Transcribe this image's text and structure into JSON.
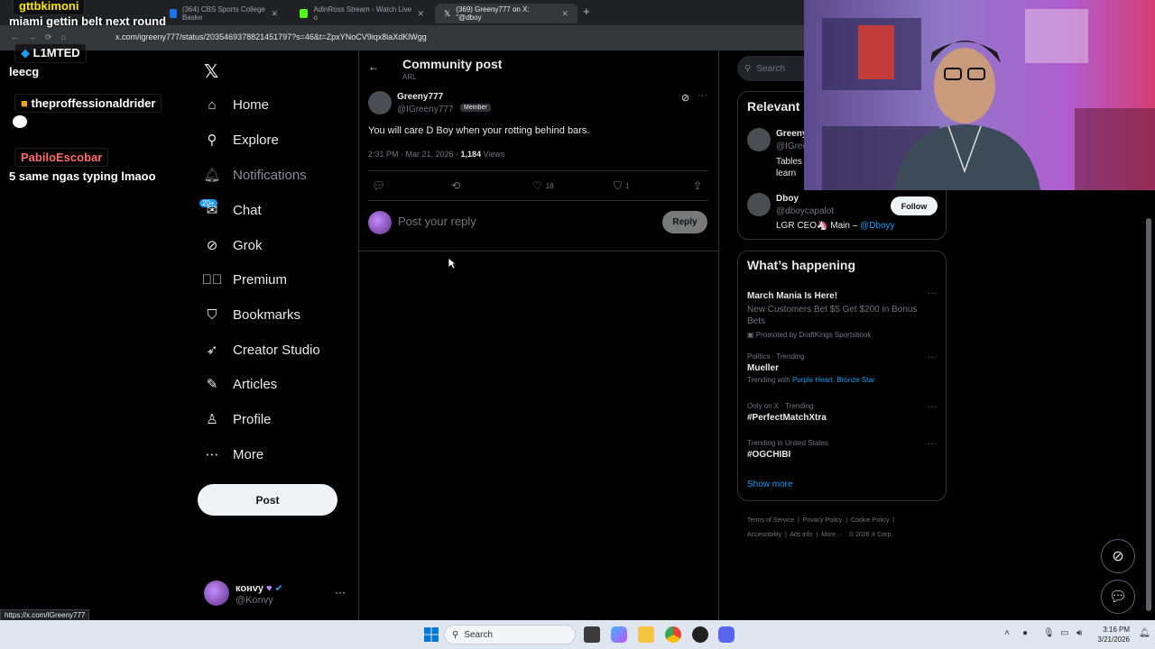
{
  "browser": {
    "tabs": [
      {
        "label": "(364) CBS Sports College Baske",
        "favicon_color": "#1a73e8"
      },
      {
        "label": "AdinRoss Stream - Watch Live o",
        "favicon_color": "#53fc18"
      },
      {
        "label": "(369) Greeny777 on X: \"@dboy",
        "favicon_color": "#000000"
      }
    ],
    "url": "x.com/igreeny777/status/2035469378821451797?s=46&t=ZpxYNoCV9iqx8iaXdKlWgg",
    "status_url": "https://x.com/IGreeny777"
  },
  "chat_overlay": {
    "lines": [
      {
        "user": "gttbkimoni",
        "message": "miami gettin belt next round"
      },
      {
        "user": "L1MTED",
        "message": "leecg"
      },
      {
        "user": "theproffessionaldrider",
        "message": ""
      },
      {
        "user": "PabiloEscobar",
        "message": "5 same ngas typing lmaoo"
      }
    ]
  },
  "nav": {
    "items": [
      {
        "label": "Home",
        "icon": "home-icon"
      },
      {
        "label": "Explore",
        "icon": "search-icon"
      },
      {
        "label": "Notifications",
        "icon": "bell-icon"
      },
      {
        "label": "Chat",
        "icon": "mail-icon"
      },
      {
        "label": "Grok",
        "icon": "grok-icon"
      },
      {
        "label": "Premium",
        "icon": "verified-icon"
      },
      {
        "label": "Bookmarks",
        "icon": "bookmark-icon"
      },
      {
        "label": "Creator Studio",
        "icon": "rocket-icon"
      },
      {
        "label": "Articles",
        "icon": "article-icon"
      },
      {
        "label": "Profile",
        "icon": "person-icon"
      },
      {
        "label": "More",
        "icon": "more-circle-icon"
      }
    ],
    "chat_badge": "20+",
    "post_label": "Post"
  },
  "account": {
    "name": "конvy",
    "handle": "@Konvy"
  },
  "main": {
    "title": "Community post",
    "subtitle": "ARL",
    "post": {
      "name": "Greeny777",
      "handle": "@IGreeny777",
      "badge": "Member",
      "text": "You will care D Boy when your rotting behind bars.",
      "time": "2:31 PM · Mar 21, 2026 · ",
      "views": "1,184",
      "views_label": " Views",
      "likes": "18",
      "bookmarks": "1"
    },
    "reply_placeholder": "Post your reply",
    "reply_label": "Reply"
  },
  "sidebar": {
    "search_placeholder": "Search",
    "relevant_title": "Relevant people",
    "people": [
      {
        "name": "Greeny777",
        "handle": "@IGreeny777",
        "bio": "Tables learn"
      },
      {
        "name": "Dboy",
        "handle": "@dboycapalot",
        "bio": "LGR CEO🦄 Main – ",
        "bio_link": "@Dboyy",
        "follow_label": "Follow"
      }
    ],
    "happening_title": "What’s happening",
    "trends": [
      {
        "context": "",
        "title": "March Mania Is Here!",
        "desc": "New Customers Bet $5 Get $200 in Bonus Bets",
        "promo": "Promoted by DraftKings Sportsbook"
      },
      {
        "context": "Politics · Trending",
        "title": "Mueller",
        "desc": "Trending with ",
        "desc_link": "Purple Heart, Bronze Star"
      },
      {
        "context": "Only on X · Trending",
        "title": "#PerfectMatchXtra"
      },
      {
        "context": "Trending in United States",
        "title": "#OGCHIBI"
      }
    ],
    "show_more": "Show more",
    "footer": [
      "Terms of Service",
      "Privacy Policy",
      "Cookie Policy",
      "Accessibility",
      "Ads info",
      "More ···",
      "© 2026 X Corp."
    ]
  },
  "taskbar": {
    "search_placeholder": "Search",
    "time": "3:16 PM",
    "date": "3/21/2026"
  },
  "colors": {
    "accent": "#1d9bf0",
    "background": "#000000",
    "border": "#2f3336"
  }
}
